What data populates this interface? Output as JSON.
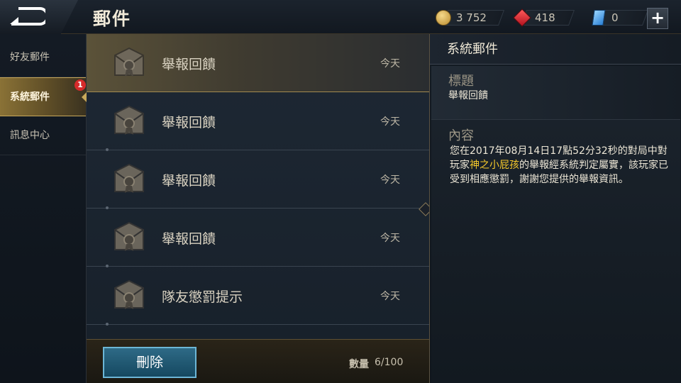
{
  "header": {
    "title": "郵件",
    "currencies": [
      {
        "icon": "coin-icon",
        "value": "3 752"
      },
      {
        "icon": "red-gem-icon",
        "value": "418"
      },
      {
        "icon": "blue-ticket-icon",
        "value": "0"
      }
    ],
    "add_label": "+"
  },
  "sidebar": {
    "items": [
      {
        "label": "好友郵件",
        "active": false
      },
      {
        "label": "系統郵件",
        "active": true,
        "badge": "1"
      },
      {
        "label": "訊息中心",
        "active": false
      }
    ]
  },
  "mail_list": {
    "items": [
      {
        "subject": "舉報回饋",
        "date": "今天",
        "selected": true
      },
      {
        "subject": "舉報回饋",
        "date": "今天",
        "selected": false
      },
      {
        "subject": "舉報回饋",
        "date": "今天",
        "selected": false
      },
      {
        "subject": "舉報回饋",
        "date": "今天",
        "selected": false
      },
      {
        "subject": "隊友懲罰提示",
        "date": "今天",
        "selected": false
      }
    ],
    "delete_label": "刪除",
    "count_label": "數量",
    "count_value": "6/100"
  },
  "detail": {
    "panel_title": "系統郵件",
    "subject_label": "標題",
    "subject_value": "舉報回饋",
    "content_label": "內容",
    "content_pre": "您在2017年08月14日17點52分32秒的對局中對玩家",
    "content_player": "神之小屁孩",
    "content_post": "的舉報經系統判定屬實，該玩家已受到相應懲罰，謝謝您提供的舉報資訊。"
  },
  "colors": {
    "accent_gold": "#c8a85a",
    "highlight_name": "#f6c92b",
    "badge_red": "#d62a2a",
    "delete_button": "#2e6a86"
  }
}
